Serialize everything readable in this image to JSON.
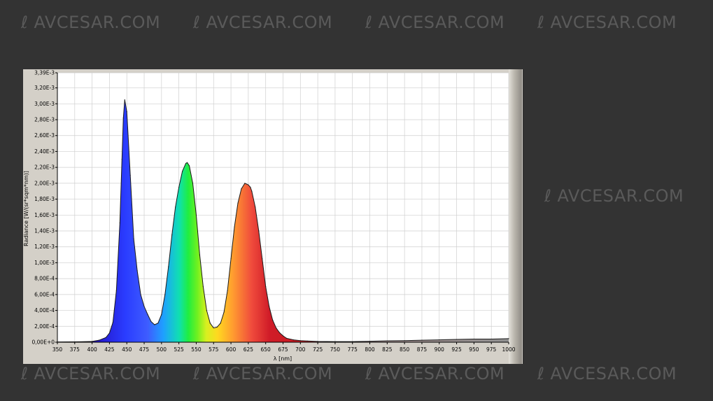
{
  "watermark": {
    "text": "AVCESAR.COM"
  },
  "colors": {
    "background": "#333333",
    "panel": "#d4d0c8",
    "plot_bg": "#ffffff",
    "grid": "#cfcfcf"
  },
  "chart_data": {
    "type": "area",
    "title": "",
    "xlabel": "λ [nm]",
    "ylabel": "Radiance [W/(sr*sqm*nm)]",
    "xlim": [
      350,
      1000
    ],
    "ylim": [
      0,
      0.00339
    ],
    "grid": true,
    "fill": "spectral-rainbow",
    "x_ticks": [
      "350",
      "375",
      "400",
      "425",
      "450",
      "475",
      "500",
      "525",
      "550",
      "575",
      "600",
      "625",
      "650",
      "675",
      "700",
      "725",
      "750",
      "775",
      "800",
      "825",
      "850",
      "875",
      "900",
      "925",
      "950",
      "975",
      "1000"
    ],
    "y_ticks": [
      "0,00E+0",
      "2,00E-4",
      "4,00E-4",
      "6,00E-4",
      "8,00E-4",
      "1,00E-3",
      "1,20E-3",
      "1,40E-3",
      "1,60E-3",
      "1,80E-3",
      "2,00E-3",
      "2,20E-3",
      "2,40E-3",
      "2,60E-3",
      "2,80E-3",
      "3,00E-3",
      "3,20E-3",
      "3,39E-3"
    ],
    "series": [
      {
        "x": [
          350,
          380,
          400,
          410,
          420,
          425,
          430,
          435,
          440,
          443,
          445,
          447,
          450,
          455,
          460,
          465,
          470,
          475,
          480,
          485,
          490,
          495,
          500,
          505,
          510,
          515,
          520,
          525,
          530,
          535,
          537,
          540,
          545,
          550,
          555,
          560,
          565,
          570,
          575,
          580,
          585,
          590,
          595,
          600,
          605,
          610,
          615,
          620,
          625,
          628,
          630,
          635,
          640,
          645,
          650,
          655,
          660,
          665,
          670,
          675,
          680,
          690,
          700,
          710,
          725,
          750,
          775,
          800,
          825,
          850,
          875,
          900,
          925,
          950,
          975,
          1000
        ],
        "y": [
          3e-06,
          5e-06,
          1e-05,
          2.5e-05,
          6e-05,
          0.000115,
          0.00025,
          0.00065,
          0.0015,
          0.0023,
          0.00282,
          0.00305,
          0.0029,
          0.0021,
          0.0013,
          0.0009,
          0.0006,
          0.00045,
          0.00035,
          0.00026,
          0.00022,
          0.00024,
          0.00035,
          0.0006,
          0.00095,
          0.00135,
          0.0017,
          0.00195,
          0.00215,
          0.00225,
          0.00226,
          0.00222,
          0.002,
          0.0016,
          0.0011,
          0.0007,
          0.0004,
          0.00024,
          0.00018,
          0.00019,
          0.00024,
          0.00038,
          0.00065,
          0.00105,
          0.00145,
          0.00175,
          0.00193,
          0.002,
          0.00198,
          0.00195,
          0.0019,
          0.0017,
          0.0014,
          0.00105,
          0.0007,
          0.00045,
          0.00028,
          0.00018,
          0.00012,
          8e-05,
          5e-05,
          3e-05,
          2e-05,
          1.5e-05,
          1e-05,
          8e-06,
          8e-06,
          1.2e-05,
          1.8e-05,
          2e-05,
          2.5e-05,
          3e-05,
          3.5e-05,
          4e-05,
          4e-05,
          4.5e-05
        ]
      }
    ]
  }
}
